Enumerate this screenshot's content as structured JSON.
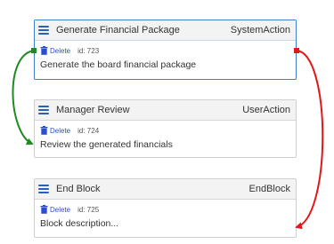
{
  "blocks": [
    {
      "title": "Generate Financial Package",
      "type": "SystemAction",
      "delete_label": "Delete",
      "id_label": "id: 723",
      "description": "Generate the board financial package",
      "menu_icon": "hamburger-menu-icon",
      "delete_icon": "trash-icon"
    },
    {
      "title": "Manager Review",
      "type": "UserAction",
      "delete_label": "Delete",
      "id_label": "id: 724",
      "description": "Review the generated financials",
      "menu_icon": "hamburger-menu-icon",
      "delete_icon": "trash-icon"
    },
    {
      "title": "End Block",
      "type": "EndBlock",
      "delete_label": "Delete",
      "id_label": "id: 725",
      "description": "Block description...",
      "menu_icon": "hamburger-menu-icon",
      "delete_icon": "trash-icon"
    }
  ],
  "colors": {
    "accent": "#2a60b8",
    "selected_border": "#3f7fcf",
    "link": "#2a4fcc",
    "success_connector": "#1f8a1f",
    "failure_connector": "#e01818"
  }
}
